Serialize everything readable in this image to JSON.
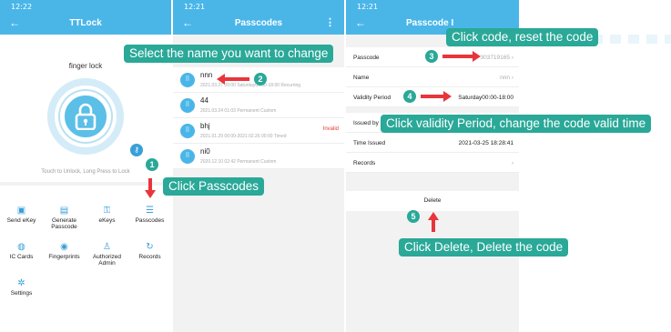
{
  "screen1": {
    "time": "12:22",
    "title": "TTLock",
    "lock_name": "finger lock",
    "hint": "Touch to Unlock, Long Press to Lock",
    "menu": [
      {
        "icon": "send-ekey-icon",
        "glyph": "▣",
        "label": "Send eKey"
      },
      {
        "icon": "generate-passcode-icon",
        "glyph": "▤",
        "label": "Generate Passcode"
      },
      {
        "icon": "ekeys-icon",
        "glyph": "⚿",
        "label": "eKeys"
      },
      {
        "icon": "passcodes-icon",
        "glyph": "☰",
        "label": "Passcodes"
      },
      {
        "icon": "ic-cards-icon",
        "glyph": "◍",
        "label": "IC Cards"
      },
      {
        "icon": "fingerprints-icon",
        "glyph": "◉",
        "label": "Fingerprints"
      },
      {
        "icon": "authorized-admin-icon",
        "glyph": "♙",
        "label": "Authorized Admin"
      },
      {
        "icon": "records-icon",
        "glyph": "↻",
        "label": "Records"
      },
      {
        "icon": "settings-icon",
        "glyph": "✲",
        "label": "Settings"
      }
    ]
  },
  "screen2": {
    "time": "12:21",
    "title": "Passcodes",
    "items": [
      {
        "name": "nnn",
        "detail": "2021.03.27 00:00 Saturday00:00-18:00 Recurring",
        "status": ""
      },
      {
        "name": "44",
        "detail": "2021.03.24 01:03 Permanent Custom",
        "status": ""
      },
      {
        "name": "bhj",
        "detail": "2021.01.29 00:00-2021.02.26 00:00 Timed",
        "status": "Invalid"
      },
      {
        "name": "ni0",
        "detail": "2020.12.10 02:42 Permanent Custom",
        "status": ""
      }
    ]
  },
  "screen3": {
    "time": "12:21",
    "title": "Passcode I",
    "rows": [
      {
        "key": "Passcode",
        "value": "303719165",
        "chevron": "›"
      },
      {
        "key": "Name",
        "value": "nnn",
        "chevron": "›"
      },
      {
        "key": "Validity Period",
        "value": "Saturday00:00-18:00",
        "chevron": ""
      },
      {
        "key": "Issued by",
        "value": "",
        "chevron": ""
      },
      {
        "key": "Time Issued",
        "value": "2021-03-25 18:28:41",
        "chevron": ""
      },
      {
        "key": "Records",
        "value": "",
        "chevron": "›"
      }
    ],
    "delete_label": "Delete"
  },
  "annotations": {
    "c1": "Click Passcodes",
    "c2": "Select the name you want to change",
    "c3": "Click code, reset the code",
    "c4": "Click validity Period, change the code valid time",
    "c5": "Click Delete, Delete the code",
    "n1": "1",
    "n2": "2",
    "n3": "3",
    "n4": "4",
    "n5": "5"
  },
  "colors": {
    "header": "#4ab6e8",
    "callout": "#2aa898",
    "arrow": "#e8353b",
    "invalid": "#e53935"
  }
}
